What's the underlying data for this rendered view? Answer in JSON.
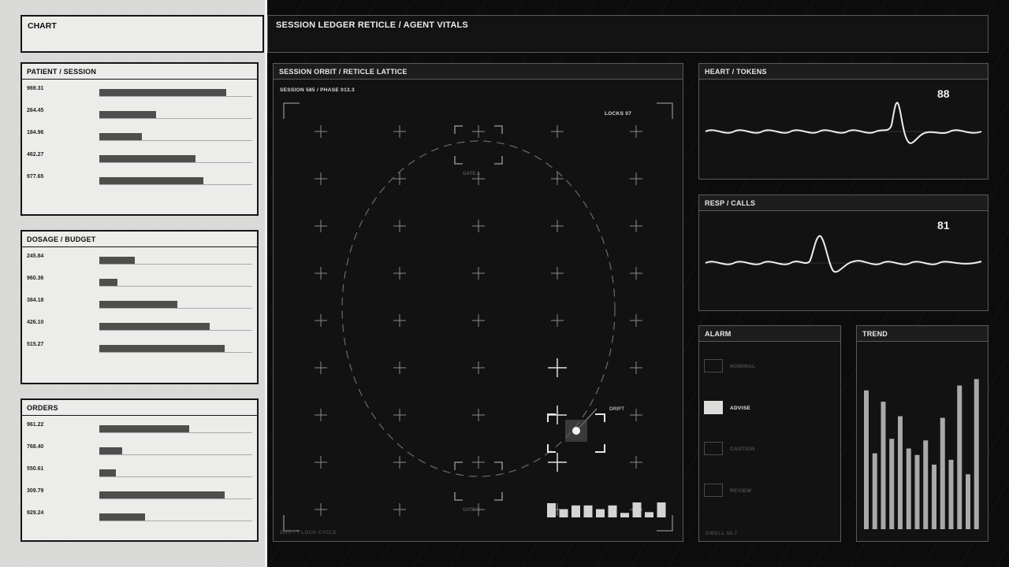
{
  "sidebar": {
    "title": "CHART",
    "panels": [
      {
        "title": "PATIENT / SESSION",
        "rows": [
          {
            "label": "969.31",
            "fill": 0.83
          },
          {
            "label": "264.45",
            "fill": 0.37
          },
          {
            "label": "184.96",
            "fill": 0.28
          },
          {
            "label": "462.27",
            "fill": 0.63
          },
          {
            "label": "977.65",
            "fill": 0.68
          }
        ]
      },
      {
        "title": "DOSAGE / BUDGET",
        "rows": [
          {
            "label": "245.84",
            "fill": 0.23
          },
          {
            "label": "960.36",
            "fill": 0.12
          },
          {
            "label": "384.18",
            "fill": 0.51
          },
          {
            "label": "426.10",
            "fill": 0.72
          },
          {
            "label": "515.27",
            "fill": 0.82
          }
        ]
      },
      {
        "title": "ORDERS",
        "rows": [
          {
            "label": "961.22",
            "fill": 0.59
          },
          {
            "label": "768.40",
            "fill": 0.15
          },
          {
            "label": "550.61",
            "fill": 0.11
          },
          {
            "label": "309.79",
            "fill": 0.82
          },
          {
            "label": "929.24",
            "fill": 0.3
          }
        ]
      }
    ]
  },
  "header": {
    "title": "SESSION LEDGER RETICLE / AGENT VITALS"
  },
  "reticle": {
    "title": "SESSION ORBIT / RETICLE LATTICE",
    "session_label": "SESSION 585 / PHASE 013.3",
    "locks_label": "LOCKS 07",
    "gate_top": "GATE A",
    "gate_bottom": "GATE B",
    "drift_label": "DRIFT",
    "footer_label": "DRIFT / LOCK CYCLE",
    "histogram": [
      0.95,
      0.55,
      0.8,
      0.8,
      0.55,
      0.8,
      0.3,
      1.0,
      0.35,
      1.0
    ]
  },
  "heart": {
    "title": "HEART / TOKENS",
    "value": "88"
  },
  "resp": {
    "title": "RESP / CALLS",
    "value": "81"
  },
  "alarm": {
    "title": "ALARM",
    "items": [
      {
        "label": "NOMINAL",
        "active": false
      },
      {
        "label": "ADVISE",
        "active": true
      },
      {
        "label": "CAUTION",
        "active": false
      },
      {
        "label": "REVIEW",
        "active": false
      }
    ],
    "footer": "DWELL 66.7"
  },
  "trend": {
    "title": "TREND",
    "values": [
      0.86,
      0.47,
      0.79,
      0.56,
      0.7,
      0.5,
      0.46,
      0.55,
      0.4,
      0.69,
      0.43,
      0.89,
      0.34,
      0.93
    ]
  },
  "colors": {
    "accent": "#e8e8e6",
    "bar_dark": "#4e4f4d",
    "panel_light": "#ecedea",
    "panel_dark": "#111211"
  }
}
